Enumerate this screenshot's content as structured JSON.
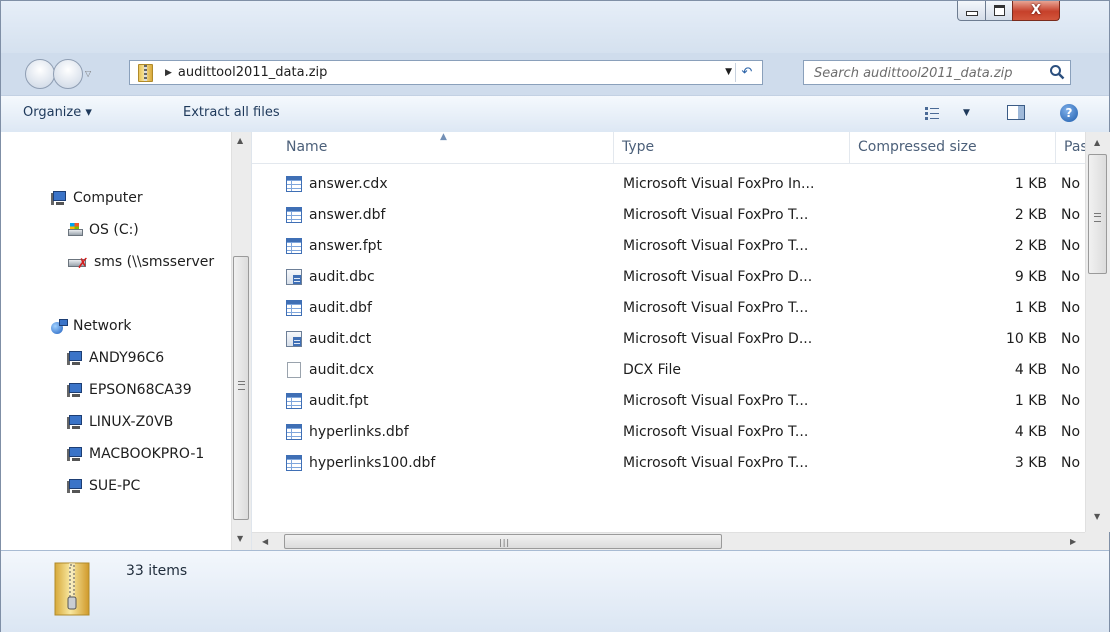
{
  "window": {
    "controls": {
      "minimize": "minimize",
      "maximize": "maximize",
      "close": "X"
    }
  },
  "address": {
    "path": "audittool2011_data.zip",
    "search_placeholder": "Search audittool2011_data.zip"
  },
  "toolbar": {
    "organize": "Organize ▾",
    "extract": "Extract all files"
  },
  "nav": {
    "computer": "Computer",
    "drives": [
      "OS (C:)",
      "sms (\\\\smsserver"
    ],
    "network": "Network",
    "hosts": [
      "ANDY96C6",
      "EPSON68CA39",
      "LINUX-Z0VB",
      "MACBOOKPRO-1",
      "SUE-PC"
    ]
  },
  "columns": {
    "name": "Name",
    "type": "Type",
    "size": "Compressed size",
    "pass": "Password"
  },
  "files": [
    {
      "name": "answer.cdx",
      "type": "Microsoft Visual FoxPro In...",
      "size": "1 KB",
      "pass": "No",
      "icon": "table-file-icon"
    },
    {
      "name": "answer.dbf",
      "type": "Microsoft Visual FoxPro T...",
      "size": "2 KB",
      "pass": "No",
      "icon": "table-file-icon"
    },
    {
      "name": "answer.fpt",
      "type": "Microsoft Visual FoxPro T...",
      "size": "2 KB",
      "pass": "No",
      "icon": "table-file-icon"
    },
    {
      "name": "audit.dbc",
      "type": "Microsoft Visual FoxPro D...",
      "size": "9 KB",
      "pass": "No",
      "icon": "database-file-icon"
    },
    {
      "name": "audit.dbf",
      "type": "Microsoft Visual FoxPro T...",
      "size": "1 KB",
      "pass": "No",
      "icon": "table-file-icon"
    },
    {
      "name": "audit.dct",
      "type": "Microsoft Visual FoxPro D...",
      "size": "10 KB",
      "pass": "No",
      "icon": "database-file-icon"
    },
    {
      "name": "audit.dcx",
      "type": "DCX File",
      "size": "4 KB",
      "pass": "No",
      "icon": "blank-file-icon"
    },
    {
      "name": "audit.fpt",
      "type": "Microsoft Visual FoxPro T...",
      "size": "1 KB",
      "pass": "No",
      "icon": "table-file-icon"
    },
    {
      "name": "hyperlinks.dbf",
      "type": "Microsoft Visual FoxPro T...",
      "size": "4 KB",
      "pass": "No",
      "icon": "table-file-icon"
    },
    {
      "name": "hyperlinks100.dbf",
      "type": "Microsoft Visual FoxPro T...",
      "size": "3 KB",
      "pass": "No",
      "icon": "table-file-icon"
    }
  ],
  "status": {
    "count": "33 items"
  }
}
